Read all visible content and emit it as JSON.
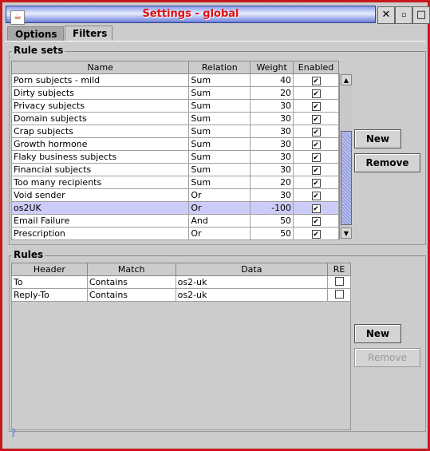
{
  "window": {
    "title": "Settings - global",
    "close": "✕",
    "minimize": "▫",
    "maximize": "□"
  },
  "tabs": [
    {
      "label": "Options",
      "active": false
    },
    {
      "label": "Filters",
      "active": true
    }
  ],
  "rulesets": {
    "legend": "Rule sets",
    "columns": [
      "Name",
      "Relation",
      "Weight",
      "Enabled"
    ],
    "rows": [
      {
        "name": "Porn subjects - mild",
        "relation": "Sum",
        "weight": "40",
        "enabled": true
      },
      {
        "name": "Dirty subjects",
        "relation": "Sum",
        "weight": "20",
        "enabled": true
      },
      {
        "name": "Privacy subjects",
        "relation": "Sum",
        "weight": "30",
        "enabled": true
      },
      {
        "name": "Domain subjects",
        "relation": "Sum",
        "weight": "30",
        "enabled": true
      },
      {
        "name": "Crap subjects",
        "relation": "Sum",
        "weight": "30",
        "enabled": true
      },
      {
        "name": "Growth hormone",
        "relation": "Sum",
        "weight": "30",
        "enabled": true
      },
      {
        "name": "Flaky business subjects",
        "relation": "Sum",
        "weight": "30",
        "enabled": true
      },
      {
        "name": "Financial subjects",
        "relation": "Sum",
        "weight": "30",
        "enabled": true
      },
      {
        "name": "Too many recipients",
        "relation": "Sum",
        "weight": "20",
        "enabled": true
      },
      {
        "name": "Void sender",
        "relation": "Or",
        "weight": "30",
        "enabled": true
      },
      {
        "name": "os2UK",
        "relation": "Or",
        "weight": "-100",
        "enabled": true,
        "selected": true
      },
      {
        "name": "Email Failure",
        "relation": "And",
        "weight": "50",
        "enabled": true
      },
      {
        "name": "Prescription",
        "relation": "Or",
        "weight": "50",
        "enabled": true
      }
    ],
    "new": "New",
    "remove": "Remove"
  },
  "rules": {
    "legend": "Rules",
    "columns": [
      "Header",
      "Match",
      "Data",
      "RE"
    ],
    "rows": [
      {
        "header": "To",
        "match": "Contains",
        "data": "os2-uk",
        "re": false
      },
      {
        "header": "Reply-To",
        "match": "Contains",
        "data": "os2-uk",
        "re": false
      }
    ],
    "new": "New",
    "remove": "Remove"
  },
  "help": "?"
}
